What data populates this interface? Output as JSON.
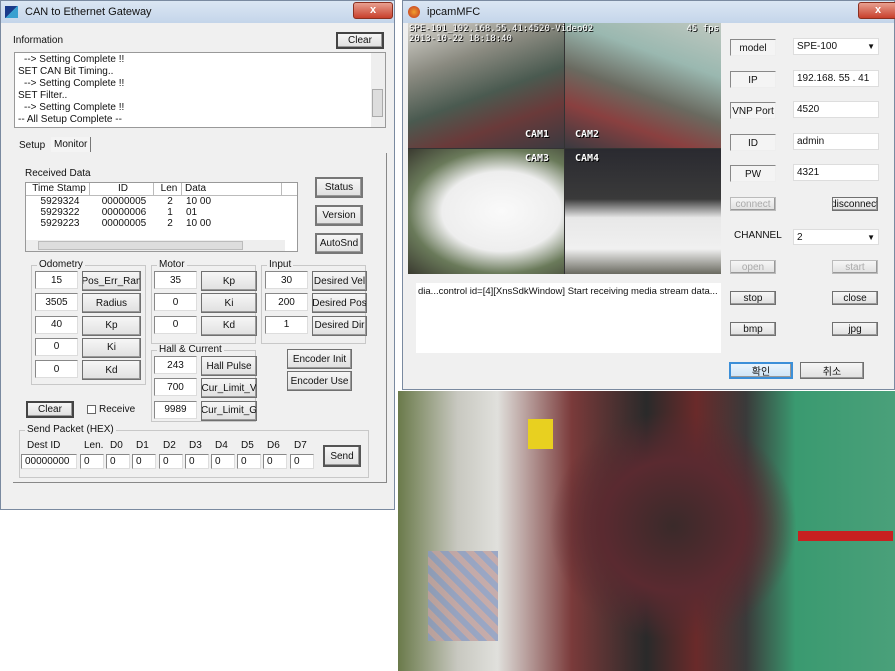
{
  "can_window": {
    "title": "CAN to Ethernet Gateway",
    "close_label": "x",
    "information_label": "Information",
    "clear_label": "Clear",
    "log_lines": [
      "--> Setting Complete !!",
      "SET CAN Bit Timing..",
      "--> Setting Complete !!",
      "SET Filter..",
      "--> Setting Complete !!",
      "-- All Setup Complete --"
    ],
    "tabs": [
      {
        "label": "Setup",
        "active": false
      },
      {
        "label": "Monitor",
        "active": true
      }
    ],
    "received_data_label": "Received Data",
    "table": {
      "columns": [
        "Time Stamp",
        "ID",
        "Len",
        "Data"
      ],
      "rows": [
        [
          "5929324",
          "00000005",
          "2",
          "10 00"
        ],
        [
          "5929322",
          "00000006",
          "1",
          "01"
        ],
        [
          "5929223",
          "00000005",
          "2",
          "10 00"
        ]
      ]
    },
    "side_buttons": [
      "Status",
      "Version",
      "AutoSnd"
    ],
    "odometry": {
      "label": "Odometry",
      "rows": [
        {
          "value": "15",
          "button": "Pos_Err_Ran"
        },
        {
          "value": "3505",
          "button": "Radius"
        },
        {
          "value": "40",
          "button": "Kp"
        },
        {
          "value": "0",
          "button": "Ki"
        },
        {
          "value": "0",
          "button": "Kd"
        }
      ]
    },
    "motor": {
      "label": "Motor",
      "rows": [
        {
          "value": "35",
          "button": "Kp"
        },
        {
          "value": "0",
          "button": "Ki"
        },
        {
          "value": "0",
          "button": "Kd"
        }
      ]
    },
    "input": {
      "label": "Input",
      "rows": [
        {
          "value": "30",
          "button": "Desired Vel"
        },
        {
          "value": "200",
          "button": "Desired Pos"
        },
        {
          "value": "1",
          "button": "Desired Dir"
        }
      ]
    },
    "hall": {
      "label": "Hall & Current",
      "rows": [
        {
          "value": "243",
          "button": "Hall Pulse"
        },
        {
          "value": "700",
          "button": "Cur_Limit_V"
        },
        {
          "value": "9989",
          "button": "Cur_Limit_G"
        }
      ]
    },
    "encoder_init": "Encoder Init",
    "encoder_use": "Encoder Use",
    "clear2_label": "Clear",
    "receive_label": "Receive",
    "receive_checked": false,
    "send_packet": {
      "label": "Send Packet (HEX)",
      "headers": [
        "Dest ID",
        "Len.",
        "D0",
        "D1",
        "D2",
        "D3",
        "D4",
        "D5",
        "D6",
        "D7"
      ],
      "values": [
        "00000000",
        "0",
        "0",
        "0",
        "0",
        "0",
        "0",
        "0",
        "0",
        "0"
      ],
      "send_label": "Send"
    }
  },
  "ipcam_window": {
    "title": "ipcamMFC",
    "close_label": "x",
    "video_overlay_line1": "SPE-101_192.168.55.41:4520-Video02",
    "video_overlay_line2": "2013-10-22 18:18:40",
    "video_fps": "45 fps",
    "cams": [
      "CAM1",
      "CAM2",
      "CAM3",
      "CAM4"
    ],
    "log_text": "dia...control id=[4][XnsSdkWindow] Start receiving media stream data...",
    "fields": [
      {
        "label": "model",
        "value": "SPE-100",
        "dropdown": true
      },
      {
        "label": "IP",
        "value": "192.168. 55 . 41"
      },
      {
        "label": "VNP Port",
        "value": "4520"
      },
      {
        "label": "ID",
        "value": "admin"
      },
      {
        "label": "PW",
        "value": "4321"
      }
    ],
    "connect_label": "connect",
    "disconnect_label": "disconnect",
    "channel_label": "CHANNEL",
    "channel_value": "2",
    "open_label": "open",
    "start_label": "start",
    "stop_label": "stop",
    "close_btn_label": "close",
    "bmp_label": "bmp",
    "jpg_label": "jpg",
    "ok_label": "확인",
    "cancel_label": "취소"
  },
  "colors": {
    "title_bar": "#c4d5ea",
    "close_button": "#c8402c",
    "window_bg": "#f0f0f0",
    "ok_border": "#3c8fd8"
  }
}
